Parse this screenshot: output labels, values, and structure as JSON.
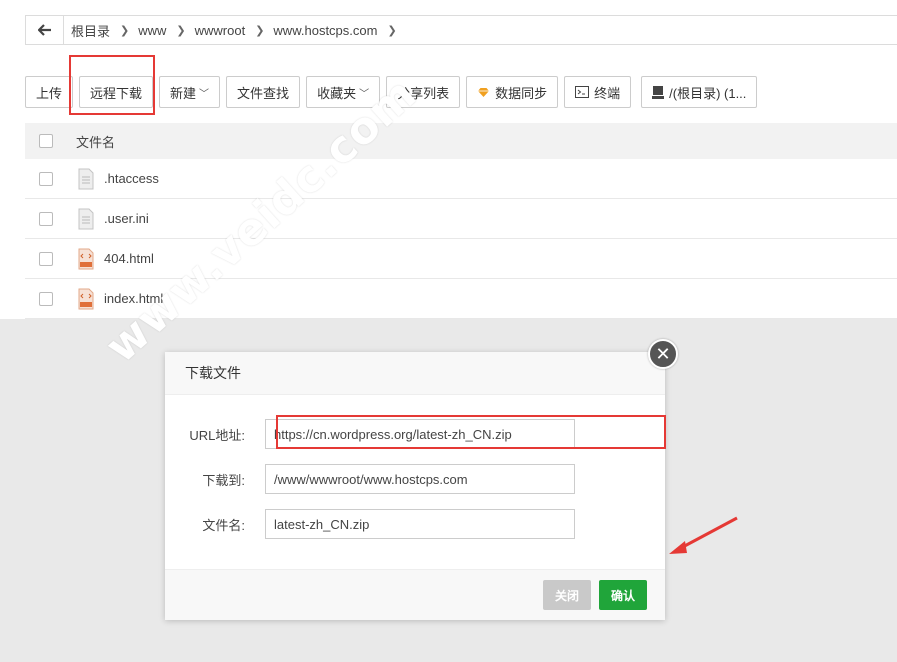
{
  "breadcrumb": {
    "items": [
      "根目录",
      "www",
      "wwwroot",
      "www.hostcps.com"
    ]
  },
  "toolbar": {
    "upload": "上传",
    "remote_download": "远程下载",
    "new": "新建",
    "file_search": "文件查找",
    "favorites": "收藏夹",
    "share_list": "分享列表",
    "data_sync": "数据同步",
    "terminal": "终端",
    "disk": "/(根目录) (1..."
  },
  "list": {
    "header": "文件名",
    "files": [
      ".htaccess",
      ".user.ini",
      "404.html",
      "index.html"
    ]
  },
  "dialog": {
    "title": "下载文件",
    "url_label": "URL地址:",
    "url_value": "https://cn.wordpress.org/latest-zh_CN.zip",
    "dest_label": "下载到:",
    "dest_value": "/www/wwwroot/www.hostcps.com",
    "filename_label": "文件名:",
    "filename_value": "latest-zh_CN.zip",
    "close_label": "关闭",
    "confirm_label": "确认"
  },
  "watermark": "www.veidc.com",
  "colors": {
    "accent_green": "#20a53a",
    "highlight_red": "#e53935"
  }
}
